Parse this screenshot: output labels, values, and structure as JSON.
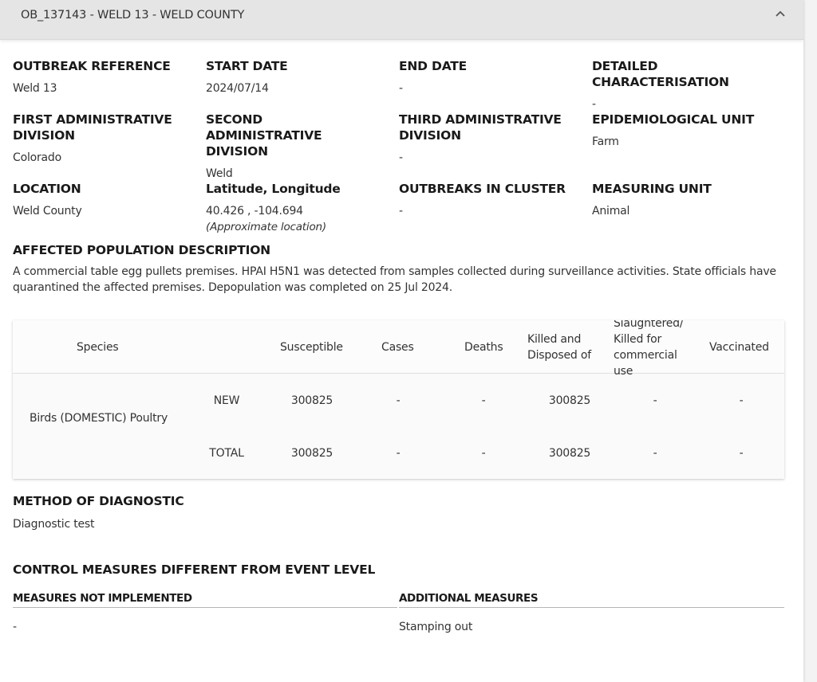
{
  "header": {
    "title": "OB_137143 - WELD 13 - WELD COUNTY"
  },
  "fields": {
    "outbreak_reference": {
      "label": "OUTBREAK REFERENCE",
      "value": "Weld 13"
    },
    "start_date": {
      "label": "START DATE",
      "value": "2024/07/14"
    },
    "end_date": {
      "label": "END DATE",
      "value": "-"
    },
    "detailed_characterisation": {
      "label": "DETAILED CHARACTERISATION",
      "value": "-"
    },
    "first_admin_division": {
      "label": "FIRST ADMINISTRATIVE DIVISION",
      "value": "Colorado"
    },
    "second_admin_division": {
      "label": "SECOND ADMINISTRATIVE DIVISION",
      "value": "Weld"
    },
    "third_admin_division": {
      "label": "THIRD ADMINISTRATIVE DIVISION",
      "value": "-"
    },
    "epidemiological_unit": {
      "label": "EPIDEMIOLOGICAL UNIT",
      "value": "Farm"
    },
    "location": {
      "label": "LOCATION",
      "value": "Weld County"
    },
    "lat_long": {
      "label": "Latitude, Longitude",
      "value": "40.426 , -104.694",
      "note": "(Approximate location)"
    },
    "outbreaks_in_cluster": {
      "label": "OUTBREAKS IN CLUSTER",
      "value": "-"
    },
    "measuring_unit": {
      "label": "MEASURING UNIT",
      "value": "Animal"
    }
  },
  "affected_population": {
    "title": "AFFECTED POPULATION DESCRIPTION",
    "text": "A commercial table egg pullets premises. HPAI H5N1 was detected from samples collected during surveillance activities. State officials have quarantined the affected premises. Depopulation was completed on 25 Jul 2024."
  },
  "table": {
    "headers": {
      "species": "Species",
      "susceptible": "Susceptible",
      "cases": "Cases",
      "deaths": "Deaths",
      "killed_disposed": "Killed and Disposed of",
      "slaughtered": "Slaughtered/ Killed for commercial use",
      "vaccinated": "Vaccinated"
    },
    "species_name": "Birds (DOMESTIC) Poultry",
    "rows": [
      {
        "type": "NEW",
        "susceptible": "300825",
        "cases": "-",
        "deaths": "-",
        "killed": "300825",
        "slaughtered": "-",
        "vaccinated": "-"
      },
      {
        "type": "TOTAL",
        "susceptible": "300825",
        "cases": "-",
        "deaths": "-",
        "killed": "300825",
        "slaughtered": "-",
        "vaccinated": "-"
      }
    ]
  },
  "diagnostic": {
    "title": "METHOD OF DIAGNOSTIC",
    "value": "Diagnostic test"
  },
  "control": {
    "title": "CONTROL MEASURES DIFFERENT FROM EVENT LEVEL",
    "not_implemented_label": "MEASURES NOT IMPLEMENTED",
    "not_implemented_value": "-",
    "additional_label": "ADDITIONAL MEASURES",
    "additional_value": "Stamping out"
  },
  "icons": {
    "collapse": "chevron-up-icon"
  }
}
